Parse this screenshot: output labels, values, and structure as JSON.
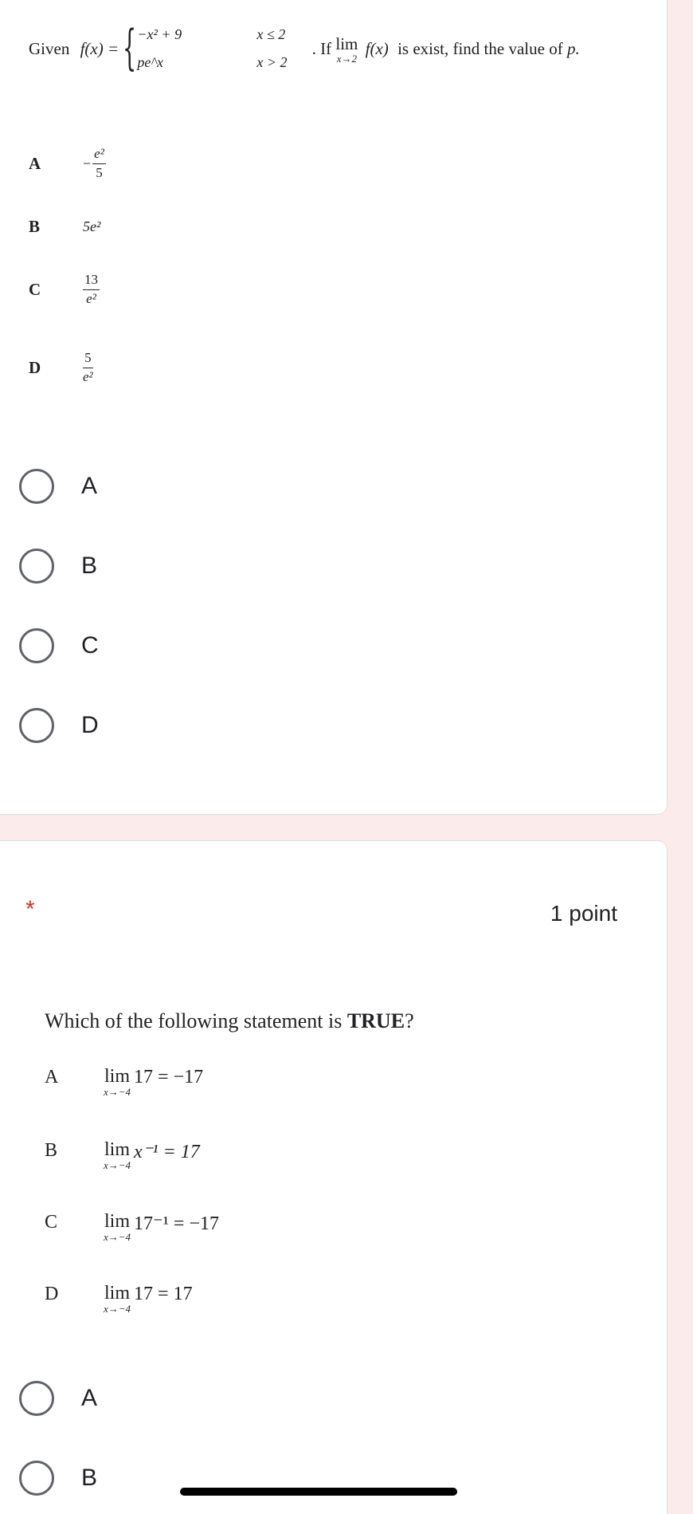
{
  "question1": {
    "given": "Given",
    "fx": "f(x) =",
    "case1_expr": "−x² + 9",
    "case1_cond": "x ≤ 2",
    "case2_expr": "pe^x",
    "case2_cond": "x > 2",
    "if_text": ". If",
    "lim_word": "lim",
    "lim_sub": "x→2",
    "lim_func": "f(x)",
    "rest_text": "is exist, find the value of",
    "var_p": "p."
  },
  "question1_choices": [
    {
      "letter": "A",
      "num": "e²",
      "den": "5",
      "sign": "−"
    },
    {
      "letter": "B",
      "text": "5e²"
    },
    {
      "letter": "C",
      "num": "13",
      "den": "e²"
    },
    {
      "letter": "D",
      "num": "5",
      "den": "e²"
    }
  ],
  "question1_options": [
    "A",
    "B",
    "C",
    "D"
  ],
  "question2": {
    "required_mark": "*",
    "points": "1 point",
    "prompt": "Which of the following statement is",
    "prompt_bold": "TRUE",
    "prompt_end": "?"
  },
  "question2_choices": [
    {
      "letter": "A",
      "lim": "lim",
      "sub": "x→−4",
      "expr": "17 = −17"
    },
    {
      "letter": "B",
      "lim": "lim",
      "sub": "x→−4",
      "expr": "x⁻¹ = 17"
    },
    {
      "letter": "C",
      "lim": "lim",
      "sub": "x→−4",
      "expr": "17⁻¹ = −17"
    },
    {
      "letter": "D",
      "lim": "lim",
      "sub": "x→−4",
      "expr": "17 = 17"
    }
  ],
  "question2_options": [
    "A",
    "B"
  ]
}
